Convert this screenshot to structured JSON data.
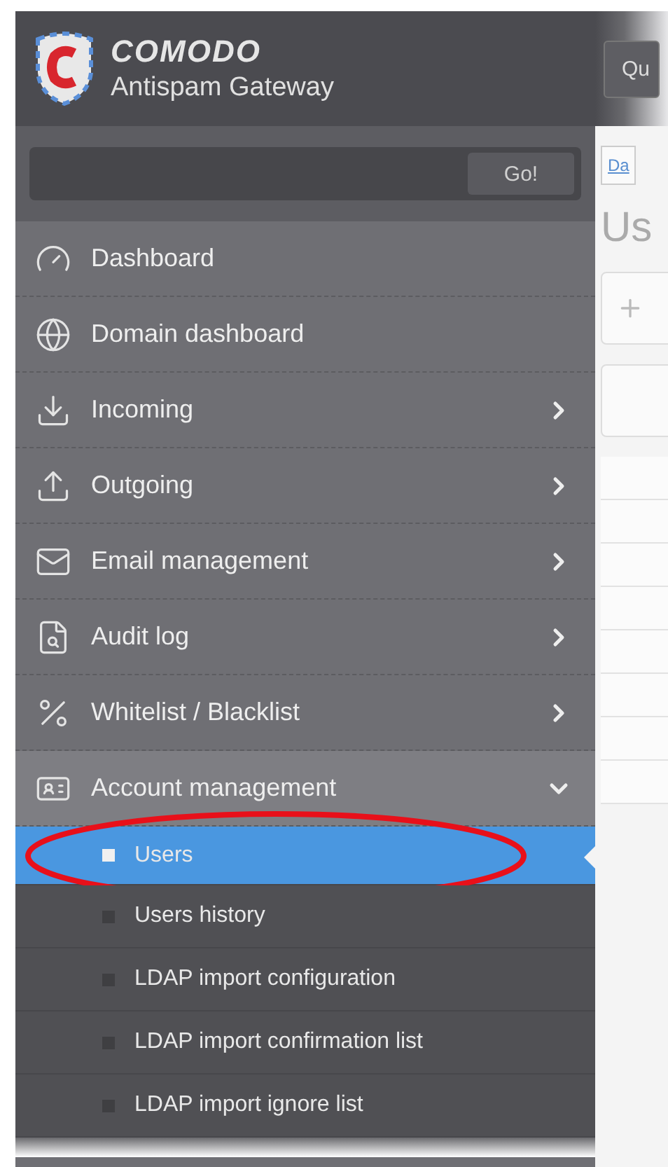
{
  "header": {
    "brand": "COMODO",
    "product": "Antispam Gateway",
    "button_partial": "Qu"
  },
  "search": {
    "button": "Go!"
  },
  "menu": [
    {
      "label": "Dashboard",
      "kind": "gauge",
      "has_arrow": false,
      "expanded": false
    },
    {
      "label": "Domain dashboard",
      "kind": "globe",
      "has_arrow": false,
      "expanded": false
    },
    {
      "label": "Incoming",
      "kind": "incoming",
      "has_arrow": true,
      "expanded": false
    },
    {
      "label": "Outgoing",
      "kind": "outgoing",
      "has_arrow": true,
      "expanded": false
    },
    {
      "label": "Email management",
      "kind": "email",
      "has_arrow": true,
      "expanded": false
    },
    {
      "label": "Audit log",
      "kind": "audit",
      "has_arrow": true,
      "expanded": false
    },
    {
      "label": "Whitelist / Blacklist",
      "kind": "lists",
      "has_arrow": true,
      "expanded": false
    },
    {
      "label": "Account management",
      "kind": "account",
      "has_arrow": true,
      "expanded": true,
      "children": [
        {
          "label": "Users",
          "selected": true,
          "highlighted": true
        },
        {
          "label": "Users history",
          "selected": false,
          "highlighted": false
        },
        {
          "label": "LDAP import configuration",
          "selected": false,
          "highlighted": false
        },
        {
          "label": "LDAP import confirmation list",
          "selected": false,
          "highlighted": false
        },
        {
          "label": "LDAP import ignore list",
          "selected": false,
          "highlighted": false
        }
      ]
    }
  ],
  "content": {
    "breadcrumb_partial": "Da",
    "title_partial": "Us"
  }
}
